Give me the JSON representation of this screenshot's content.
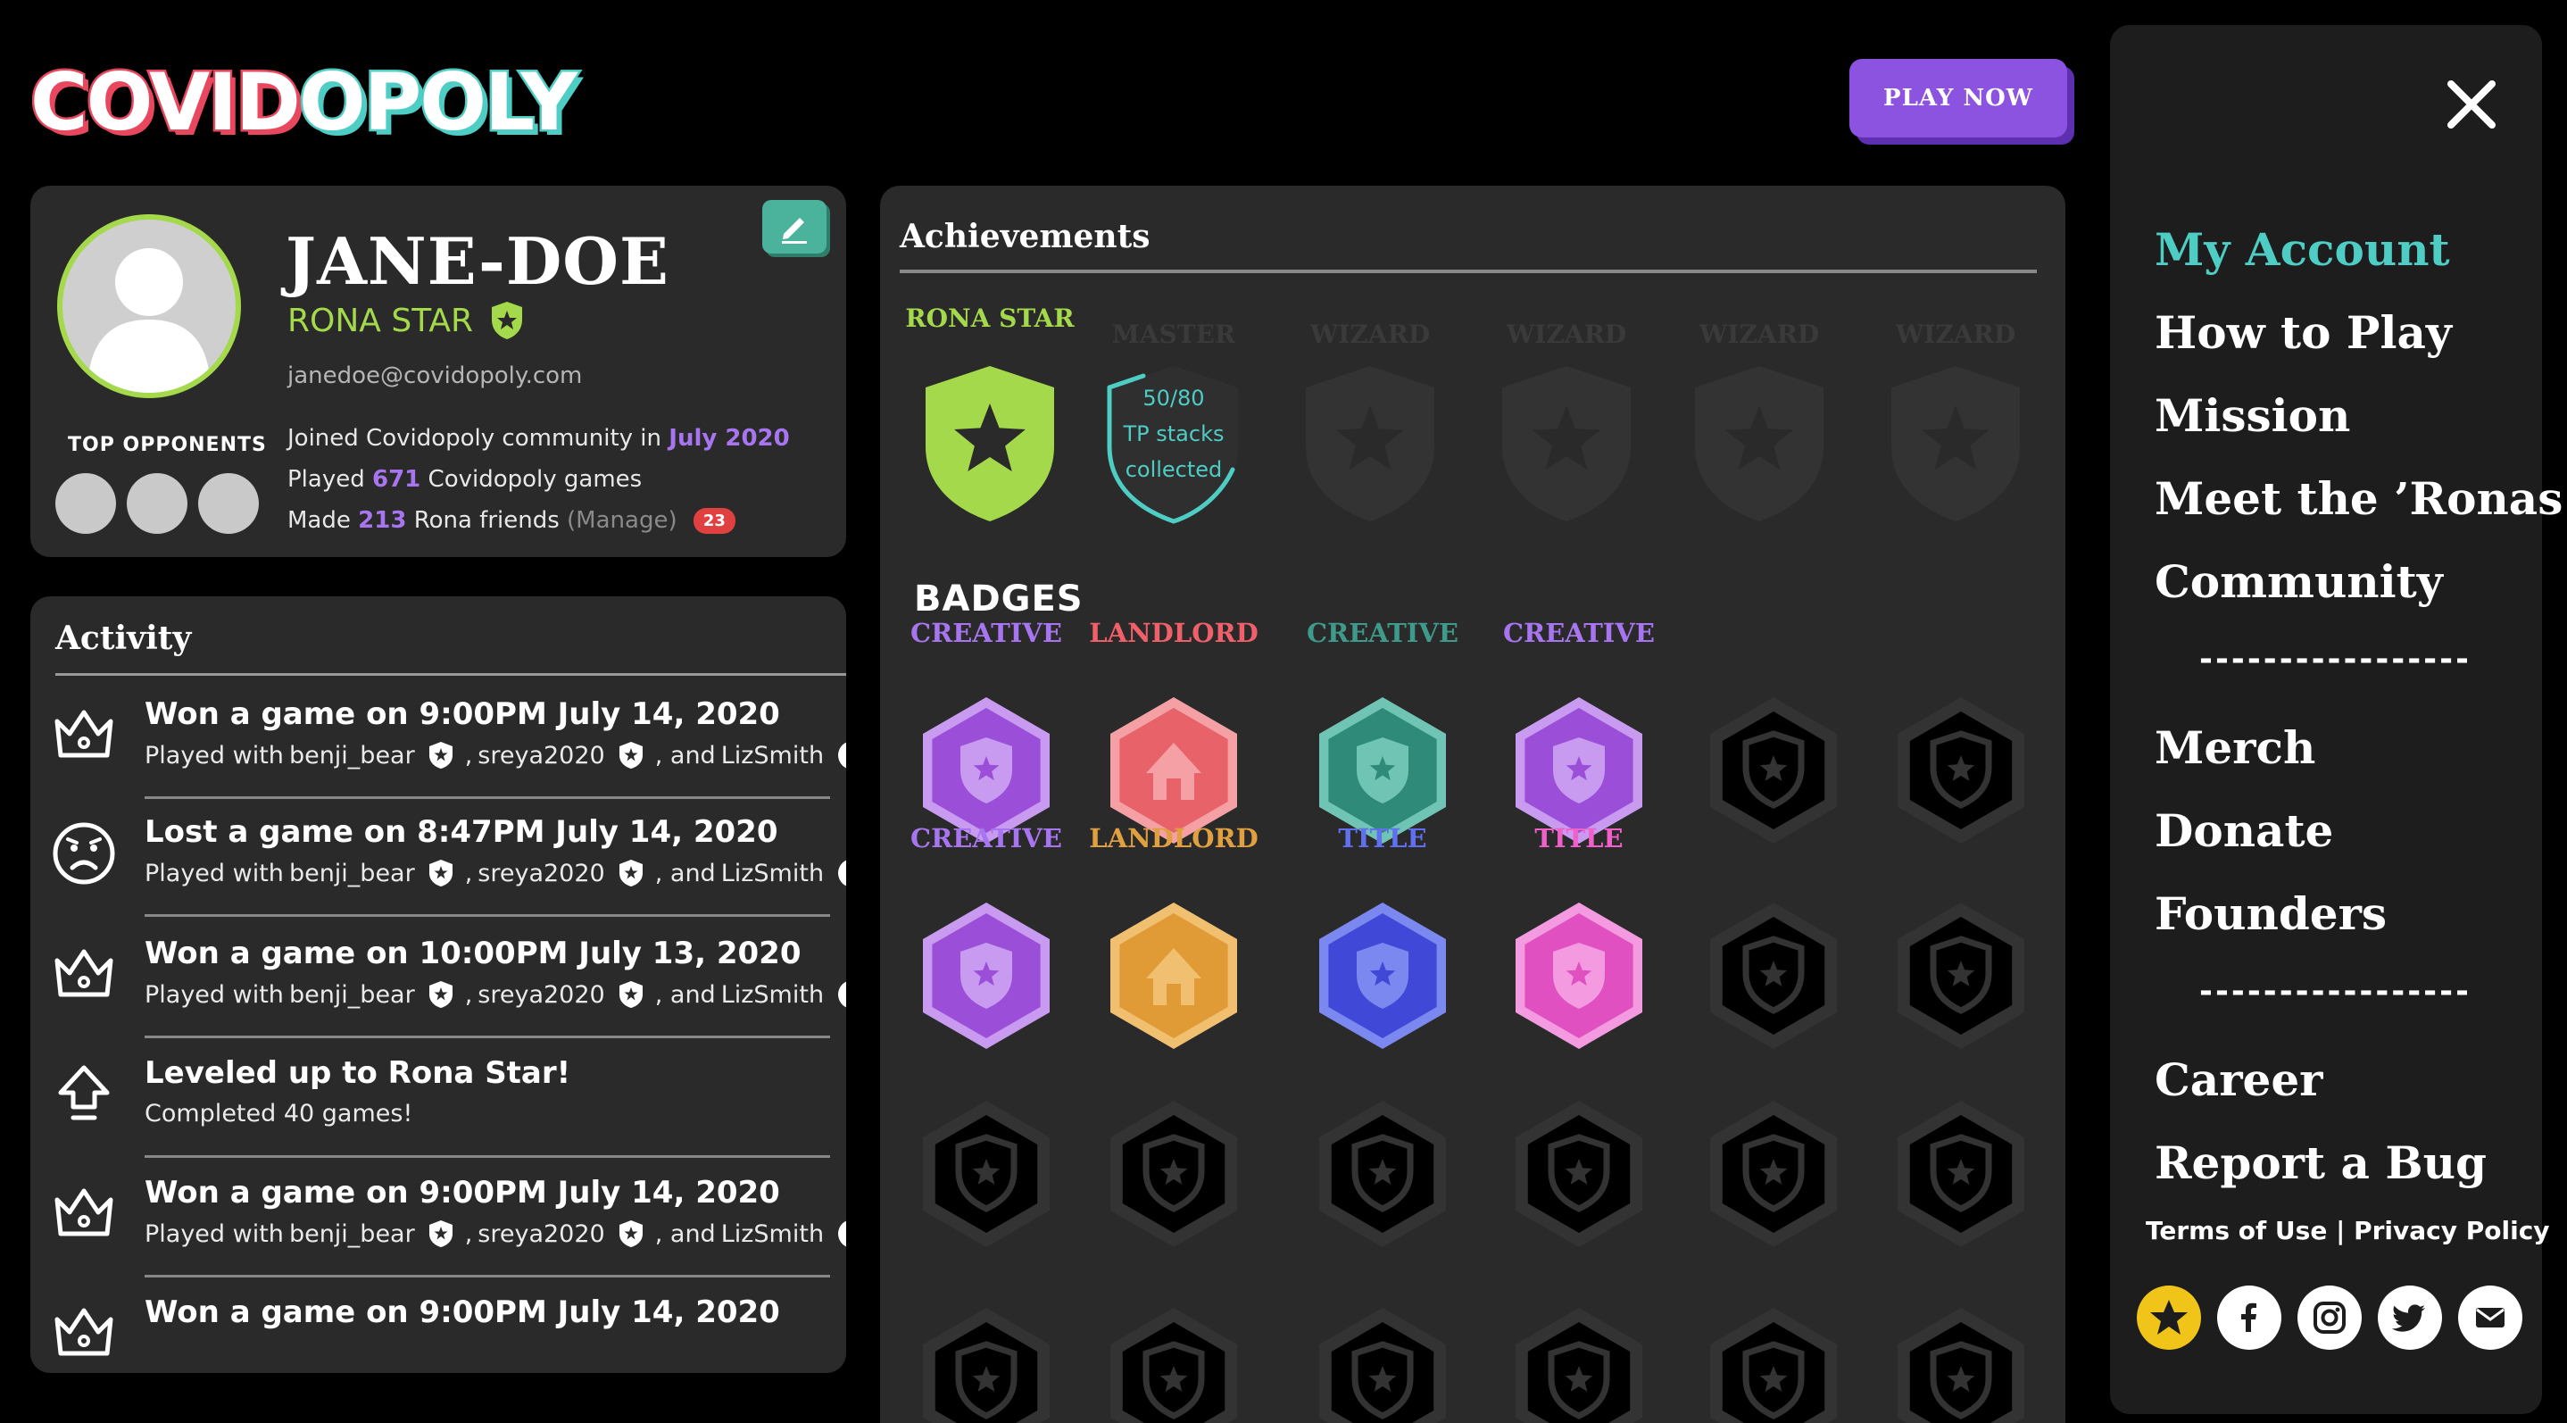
{
  "logo": {
    "part1": "COVID",
    "part2": "OPOLY"
  },
  "header": {
    "play_now": "PLAY NOW"
  },
  "profile": {
    "username": "JANE-DOE",
    "rank": "RONA STAR",
    "email": "janedoe@covidopoly.com",
    "top_opponents_label": "TOP OPPONENTS",
    "joined_prefix": "Joined Covidopoly community in",
    "joined_date": "July 2020",
    "played_prefix": "Played",
    "played_count": "671",
    "played_suffix": "Covidopoly games",
    "made_prefix": "Made",
    "friends_count": "213",
    "friends_suffix": "Rona friends",
    "manage_label": "(Manage)",
    "notification_count": "23"
  },
  "activity": {
    "title": "Activity",
    "items": [
      {
        "icon": "crown-icon",
        "title": "Won a game on 9:00PM July 14, 2020",
        "players": [
          "benji_bear",
          "sreya2020",
          "LizSmith"
        ]
      },
      {
        "icon": "sad-face-icon",
        "title": "Lost a game on 8:47PM July 14, 2020",
        "players": [
          "benji_bear",
          "sreya2020",
          "LizSmith"
        ]
      },
      {
        "icon": "crown-icon",
        "title": "Won a game on 10:00PM July 13, 2020",
        "players": [
          "benji_bear",
          "sreya2020",
          "LizSmith"
        ]
      },
      {
        "icon": "level-up-arrow-icon",
        "title": "Leveled up to Rona Star!",
        "detail": "Completed 40 games!"
      },
      {
        "icon": "crown-icon",
        "title": "Won a game on 9:00PM July 14, 2020",
        "players": [
          "benji_bear",
          "sreya2020",
          "LizSmith"
        ]
      },
      {
        "icon": "crown-icon",
        "title": "Won a game on 9:00PM July 14, 2020"
      }
    ],
    "played_with": "Played with",
    "and": ", and"
  },
  "achievements": {
    "title": "Achievements",
    "items": [
      {
        "label": "RONA STAR",
        "state": "earned",
        "color": "#a3d94a"
      },
      {
        "label": "MASTER",
        "state": "progress",
        "progress_text": [
          "50/80",
          "TP stacks",
          "collected"
        ],
        "progress_fraction": 0.625,
        "color": "#4ecdc4"
      },
      {
        "label": "WIZARD",
        "state": "locked"
      },
      {
        "label": "WIZARD",
        "state": "locked"
      },
      {
        "label": "WIZARD",
        "state": "locked"
      },
      {
        "label": "WIZARD",
        "state": "locked"
      }
    ],
    "badges_title": "BADGES",
    "badges": [
      {
        "label": "CREATIVE",
        "label_color": "#a875f0",
        "fill": "#9b4fd8",
        "light": "#c89af0",
        "icon": "shield"
      },
      {
        "label": "LANDLORD",
        "label_color": "#f0606a",
        "fill": "#e8626a",
        "light": "#f4a0a4",
        "icon": "house"
      },
      {
        "label": "CREATIVE",
        "label_color": "#3e9a8a",
        "fill": "#2f8a7a",
        "light": "#6fc4b4",
        "icon": "shield"
      },
      {
        "label": "CREATIVE",
        "label_color": "#a875f0",
        "fill": "#9b4fd8",
        "light": "#c89af0",
        "icon": "shield"
      },
      {
        "label": "",
        "locked": true
      },
      {
        "label": "",
        "locked": true
      },
      {
        "label": "CREATIVE",
        "label_color": "#a875f0",
        "fill": "#9b4fd8",
        "light": "#c89af0",
        "icon": "shield"
      },
      {
        "label": "LANDLORD",
        "label_color": "#e0a040",
        "fill": "#e09a36",
        "light": "#f0c070",
        "icon": "house"
      },
      {
        "label": "TITLE",
        "label_color": "#6070f0",
        "fill": "#4048d8",
        "light": "#7a88f0",
        "icon": "shield"
      },
      {
        "label": "TITLE",
        "label_color": "#f060c8",
        "fill": "#e050c0",
        "light": "#f49ae0",
        "icon": "shield"
      },
      {
        "label": "",
        "locked": true
      },
      {
        "label": "",
        "locked": true
      }
    ]
  },
  "menu": {
    "items_top": [
      "My Account",
      "How to Play",
      "Mission",
      "Meet the ’Ronas",
      "Community"
    ],
    "separator": "-------------------",
    "items_mid": [
      "Merch",
      "Donate",
      "Founders"
    ],
    "items_bottom": [
      "Career",
      "Report a Bug"
    ],
    "terms": "Terms of Use",
    "divider": "|",
    "privacy": "Privacy Policy",
    "socials": [
      "star-icon",
      "facebook-icon",
      "instagram-icon",
      "twitter-icon",
      "mail-icon"
    ]
  },
  "colors": {
    "accent_teal": "#4ecdc4",
    "accent_purple": "#8c52e0",
    "rona_green": "#a3d94a",
    "panel": "#2a2a2a"
  }
}
